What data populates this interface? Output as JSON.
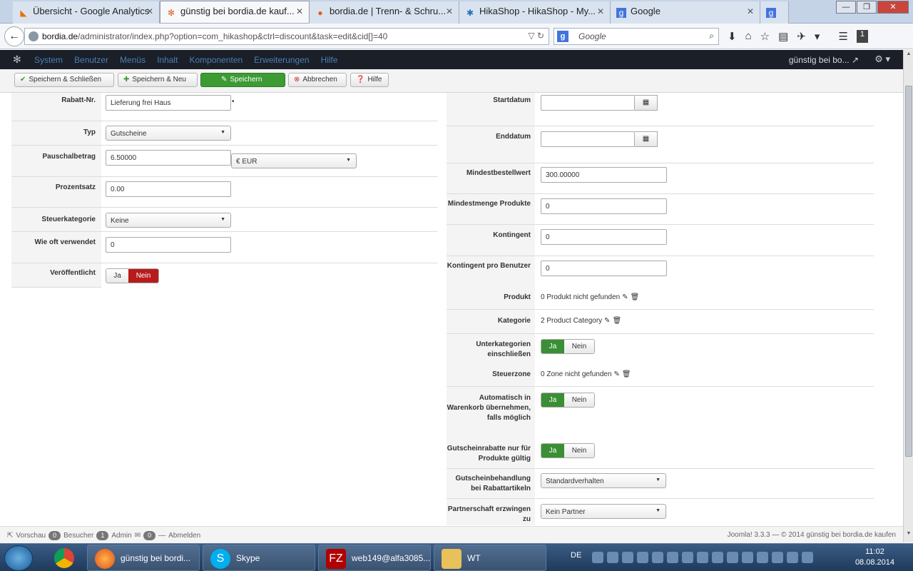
{
  "browser": {
    "tabs": [
      {
        "title": "Übersicht - Google Analytics",
        "icon": "analytics-icon",
        "color": "#e8710a"
      },
      {
        "title": "günstig bei bordia.de kauf...",
        "icon": "joomla-icon",
        "color": "#e05d20"
      },
      {
        "title": "bordia.de | Trenn- & Schru...",
        "icon": "joomla-icon",
        "color": "#e05d20"
      },
      {
        "title": "HikaShop - HikaShop - My...",
        "icon": "hikashop-icon",
        "color": "#2a6eb5"
      },
      {
        "title": "Google",
        "icon": "google-icon",
        "color": "#4273de"
      }
    ],
    "url_domain": "bordia.de",
    "url_path": "/administrator/index.php?option=com_hikashop&ctrl=discount&task=edit&cid[]=40",
    "search_placeholder": "Google",
    "search_engine": "g"
  },
  "admin_bar": {
    "menu": [
      "System",
      "Benutzer",
      "Menüs",
      "Inhalt",
      "Komponenten",
      "Erweiterungen",
      "Hilfe"
    ],
    "site_label": "günstig bei bo..."
  },
  "toolbar": {
    "save_close": "Speichern & Schließen",
    "save_new": "Speichern & Neu",
    "save": "Speichern",
    "cancel": "Abbrechen",
    "help": "Hilfe"
  },
  "left": {
    "code_label": "Rabatt-Nr.",
    "code_value": "Lieferung frei Haus",
    "type_label": "Typ",
    "type_value": "Gutscheine",
    "flat_label": "Pauschalbetrag",
    "flat_value": "6.50000",
    "currency_value": "€ EUR",
    "percent_label": "Prozentsatz",
    "percent_value": "0.00",
    "tax_label": "Steuerkategorie",
    "tax_value": "Keine",
    "used_label": "Wie oft verwendet",
    "used_value": "0",
    "published_label": "Veröffentlicht",
    "yes": "Ja",
    "no": "Nein"
  },
  "right": {
    "start_label": "Startdatum",
    "start_value": "",
    "end_label": "Enddatum",
    "end_value": "",
    "min_order_label": "Mindestbestellwert",
    "min_order_value": "300.00000",
    "min_qty_label": "Mindestmenge Produkte",
    "min_qty_value": "0",
    "quota_label": "Kontingent",
    "quota_value": "0",
    "quota_user_label": "Kontingent pro Benutzer",
    "quota_user_value": "0",
    "product_label": "Produkt",
    "product_value": "0 Produkt nicht gefunden",
    "category_label": "Kategorie",
    "category_value": "2 Product Category",
    "subcat_label": "Unterkategorien einschließen",
    "zone_label": "Steuerzone",
    "zone_value": "0 Zone nicht gefunden",
    "auto_cart_label": "Automatisch in Warenkorb übernehmen, falls möglich",
    "voucher_products_label": "Gutscheinrabatte nur für Produkte gültig",
    "voucher_handling_label": "Gutscheinbehandlung bei Rabattartikeln",
    "voucher_handling_value": "Standardverhalten",
    "partner_label": "Partnerschaft erzwingen zu",
    "partner_value": "Kein Partner",
    "yes": "Ja",
    "no": "Nein"
  },
  "status": {
    "preview": "Vorschau",
    "visitors_count": "0",
    "visitors": "Besucher",
    "admin_count": "1",
    "admin": "Admin",
    "mail_count": "0",
    "logout": "Abmelden",
    "footer": "Joomla! 3.3.3  —  © 2014 günstig bei bordia.de kaufen"
  },
  "taskbar": {
    "items": [
      {
        "label": "günstig bei bordi...",
        "icon": "firefox-icon"
      },
      {
        "label": "Skype",
        "icon": "skype-icon"
      },
      {
        "label": "web149@alfa3085...",
        "icon": "filezilla-icon"
      },
      {
        "label": "WT",
        "icon": "folder-icon"
      }
    ],
    "lang": "DE",
    "time": "11:02",
    "date": "08.08.2014"
  }
}
